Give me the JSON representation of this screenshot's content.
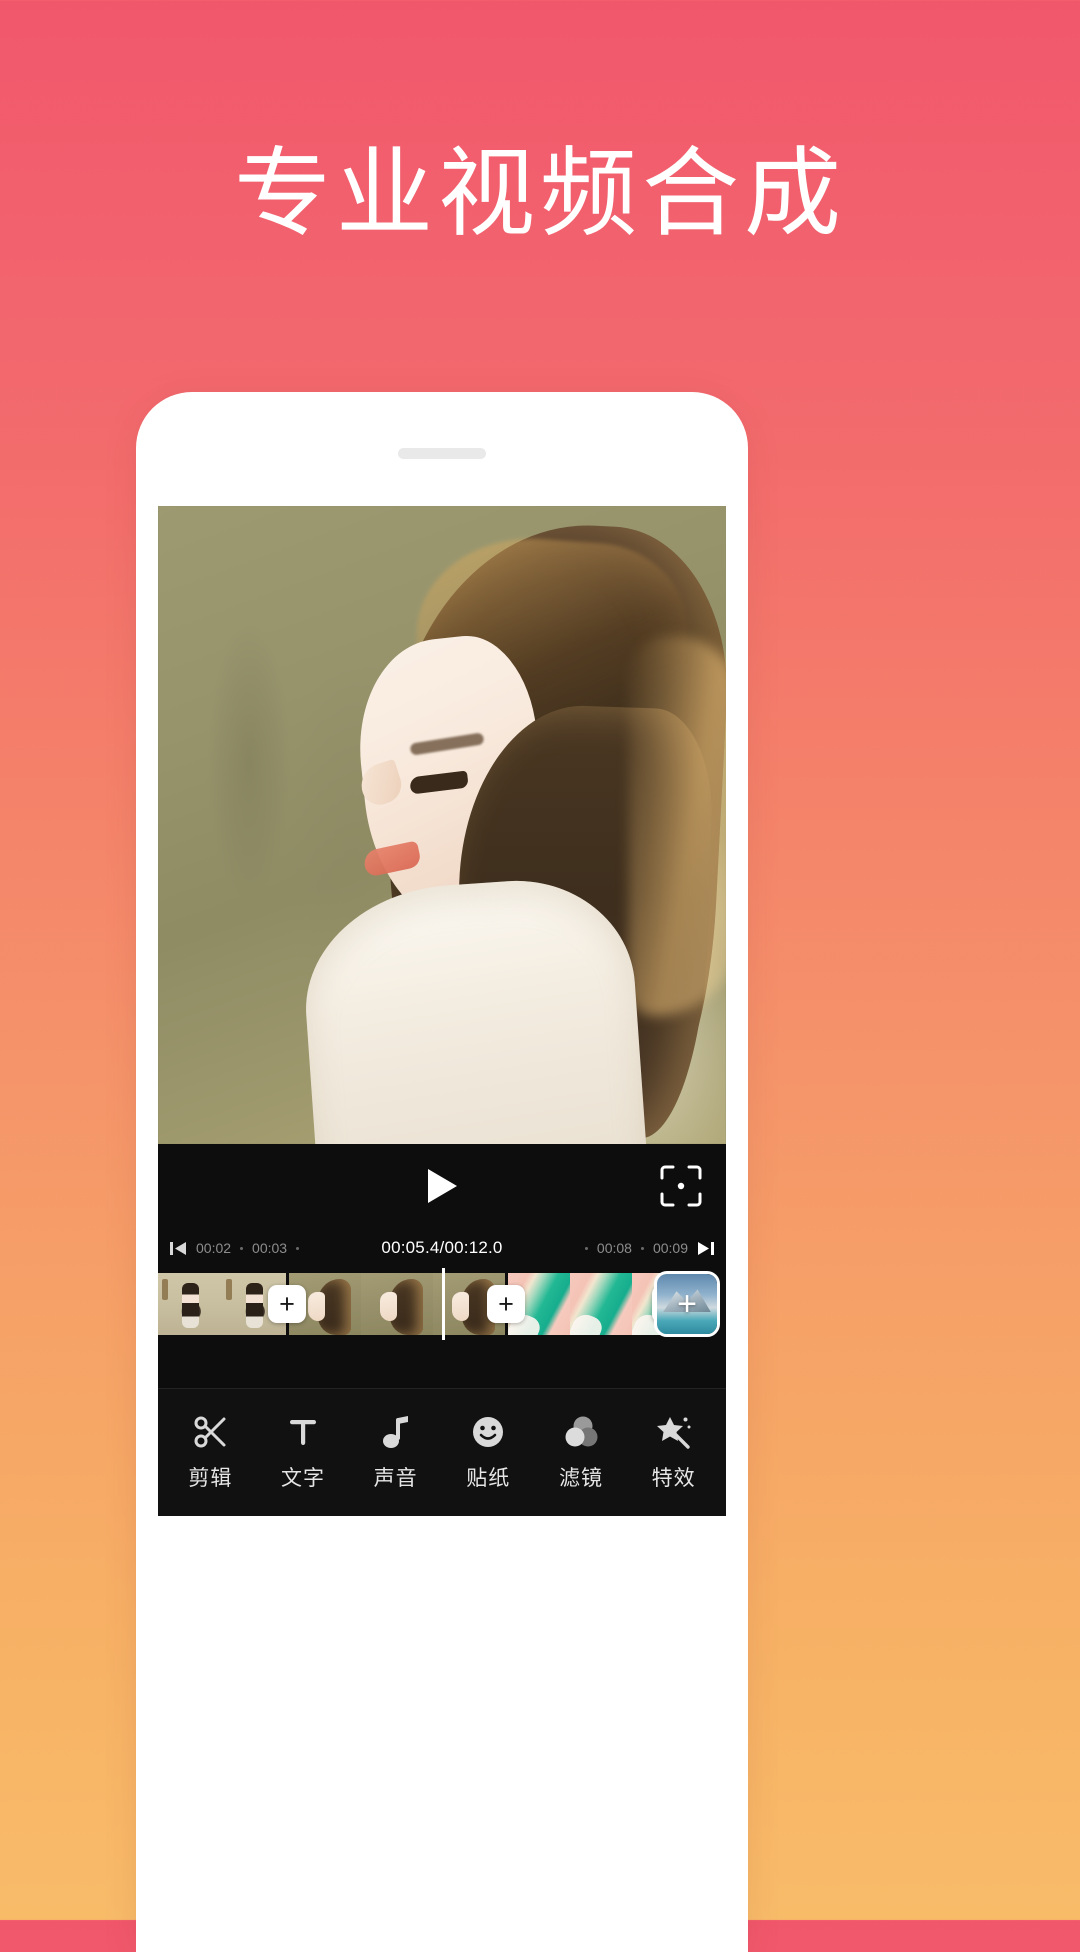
{
  "headline": "专业视频合成",
  "theme": {
    "gradient_top": "#f1576b",
    "gradient_bottom": "#f8bc69",
    "screen_bg": "#0d0d0d",
    "accent_white": "#ffffff"
  },
  "player": {
    "play_icon": "play-icon",
    "fullscreen_icon": "fullscreen-icon",
    "prev_icon": "skip-previous-icon",
    "next_icon": "skip-next-icon",
    "current_time": "00:05.4",
    "total_time": "00:12.0",
    "time_display": "00:05.4/00:12.0",
    "ticks_left": [
      "00:02",
      "00:03"
    ],
    "ticks_right": [
      "00:08",
      "00:09"
    ]
  },
  "timeline": {
    "add_transition_label": "+",
    "add_clip_label": "+",
    "clips": [
      {
        "name": "clip-girl-braids",
        "art": "art-girl",
        "thumbs": 2,
        "thumb_width": 64
      },
      {
        "name": "clip-portrait",
        "art": "art-portrait",
        "thumbs": 3,
        "thumb_width": 72
      },
      {
        "name": "clip-beach",
        "art": "art-beach",
        "thumbs": 3,
        "thumb_width": 62
      }
    ]
  },
  "toolbar": {
    "items": [
      {
        "label": "剪辑",
        "icon": "scissors-icon"
      },
      {
        "label": "文字",
        "icon": "text-icon"
      },
      {
        "label": "声音",
        "icon": "music-note-icon"
      },
      {
        "label": "贴纸",
        "icon": "sticker-smiley-icon"
      },
      {
        "label": "滤镜",
        "icon": "filter-circles-icon"
      },
      {
        "label": "特效",
        "icon": "magic-wand-icon"
      }
    ]
  }
}
